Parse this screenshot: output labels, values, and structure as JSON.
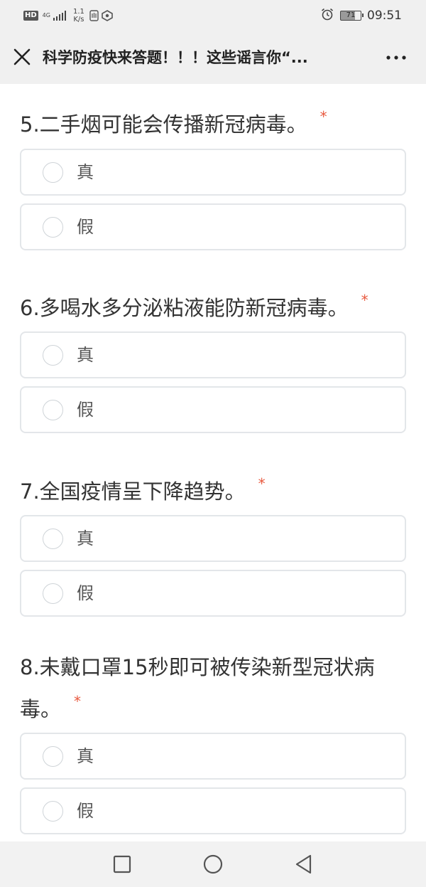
{
  "status_bar": {
    "hd": "HD",
    "network": "4G",
    "speed_value": "1.1",
    "speed_unit": "K/s",
    "battery": "71",
    "time": "09:51"
  },
  "header": {
    "title": "科学防疫快来答题！！！这些谣言你“..."
  },
  "questions": [
    {
      "title": "5.二手烟可能会传播新冠病毒。",
      "required": "*",
      "options": [
        "真",
        "假"
      ]
    },
    {
      "title": "6.多喝水多分泌粘液能防新冠病毒。",
      "required": "*",
      "options": [
        "真",
        "假"
      ]
    },
    {
      "title": "7.全国疫情呈下降趋势。",
      "required": "*",
      "options": [
        "真",
        "假"
      ]
    },
    {
      "title": "8.未戴口罩15秒即可被传染新型冠状病毒。",
      "required": "*",
      "options": [
        "真",
        "假"
      ]
    }
  ],
  "icons": {
    "close": "close-icon",
    "more": "more-icon",
    "nav_recent": "square-icon",
    "nav_home": "circle-icon",
    "nav_back": "triangle-back-icon"
  },
  "colors": {
    "required": "#e8593f",
    "header_bg": "#f0f0f0",
    "option_border": "#e3e6e9"
  }
}
